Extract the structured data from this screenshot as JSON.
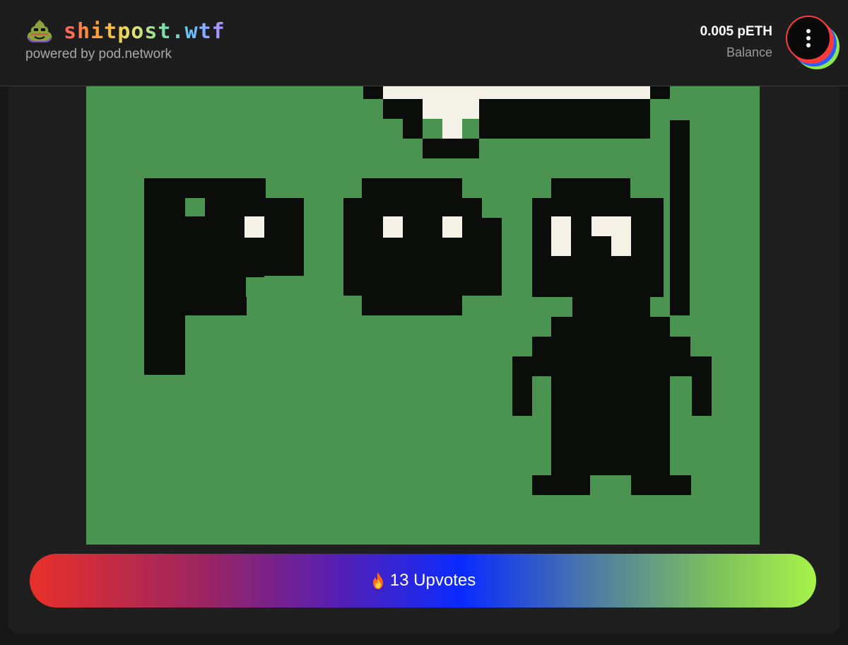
{
  "header": {
    "title": "shitpost.wtf",
    "subtitle": "powered by pod.network",
    "logo_icon": "poop-emoji-icon"
  },
  "wallet": {
    "balance_value": "0.005 pETH",
    "balance_label": "Balance",
    "menu_icon": "vertical-dots-icon"
  },
  "post": {
    "image_icon": "pixel-art-pod-image",
    "upvote_icon": "fire-icon",
    "upvote_label": "13 Upvotes"
  },
  "colors": {
    "background": "#171717",
    "header": "#1d1d1d",
    "card": "#1f1f1f",
    "image_green": "#4a9350",
    "pixel_black": "#0a0d0a",
    "pixel_white": "#f4f1e6",
    "gradient_red": "#e8302a",
    "gradient_blue": "#0a2bff",
    "gradient_green": "#a7f34a"
  }
}
